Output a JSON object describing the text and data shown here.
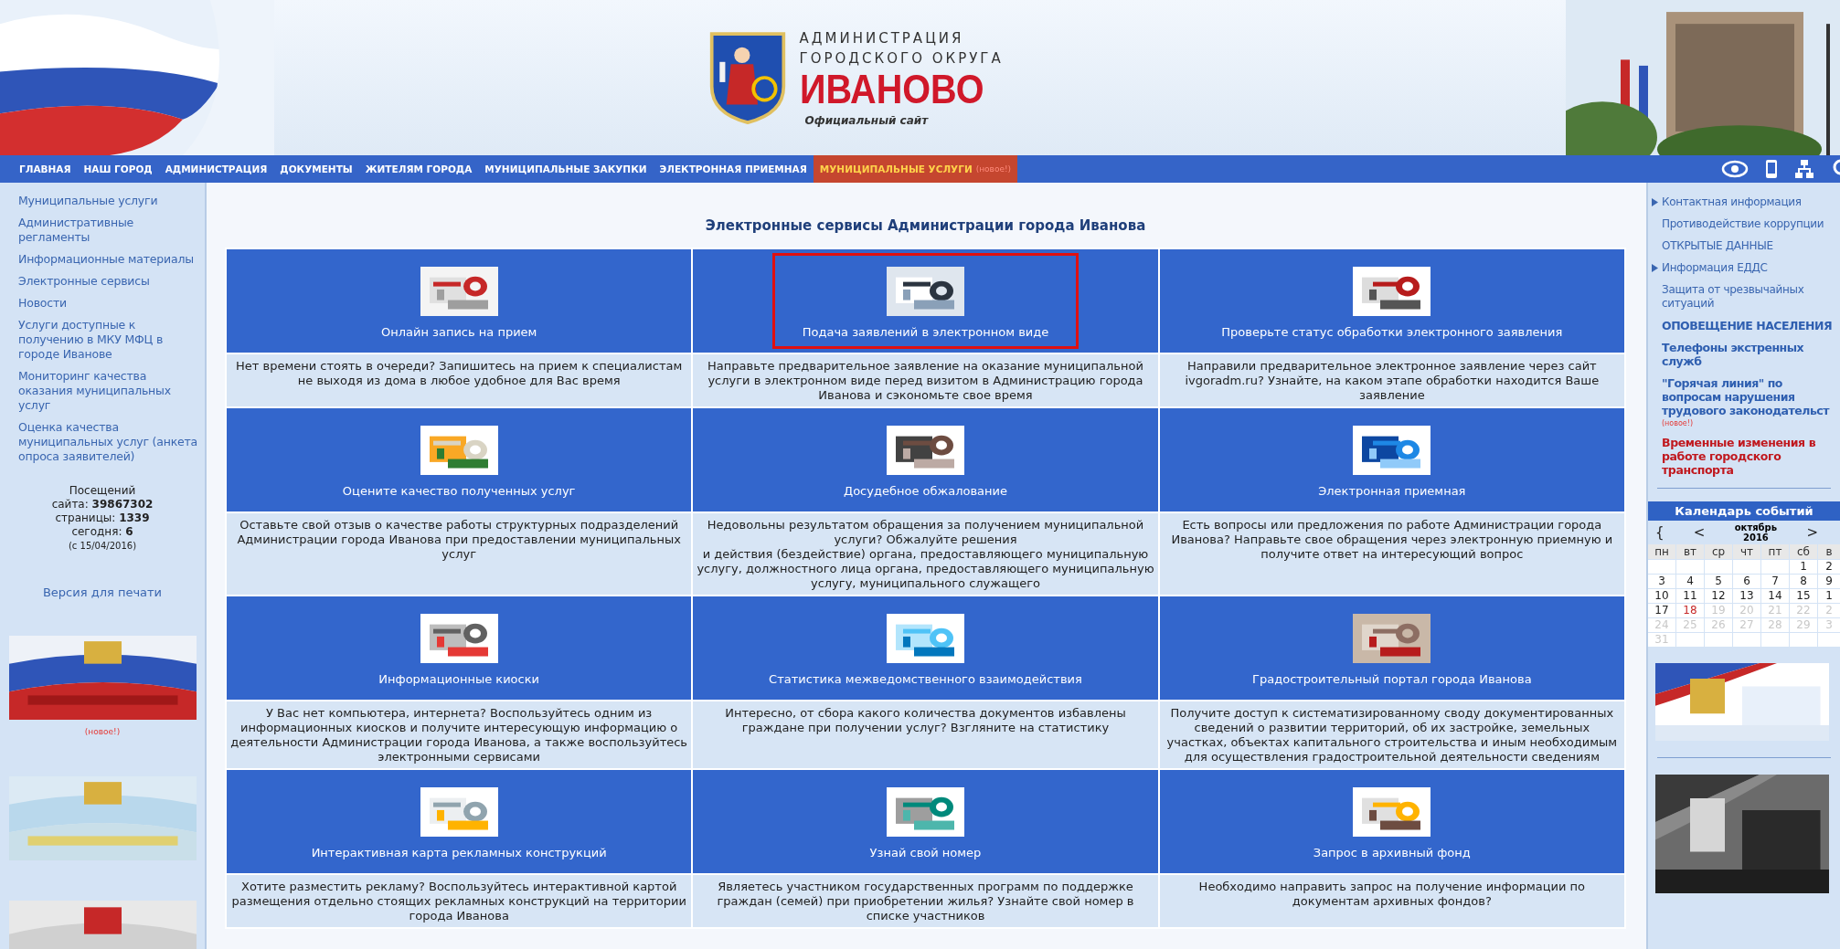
{
  "header": {
    "line1": "АДМИНИСТРАЦИЯ",
    "line2": "ГОРОДСКОГО ОКРУГА",
    "city": "ИВАНОВО",
    "subtitle": "Официальный сайт"
  },
  "nav": [
    {
      "label": "ГЛАВНАЯ",
      "selected": false
    },
    {
      "label": "НАШ ГОРОД",
      "selected": false
    },
    {
      "label": "АДМИНИСТРАЦИЯ",
      "selected": false
    },
    {
      "label": "ДОКУМЕНТЫ",
      "selected": false
    },
    {
      "label": "ЖИТЕЛЯМ ГОРОДА",
      "selected": false
    },
    {
      "label": "МУНИЦИПАЛЬНЫЕ ЗАКУПКИ",
      "selected": false
    },
    {
      "label": "ЭЛЕКТРОННАЯ ПРИЕМНАЯ",
      "selected": false
    },
    {
      "label": "МУНИЦИПАЛЬНЫЕ УСЛУГИ",
      "selected": true,
      "badge": "(новое!)"
    }
  ],
  "left_menu": [
    "Муниципальные услуги",
    "Административные регламенты",
    "Информационные материалы",
    "Электронные сервисы",
    "Новости",
    "Услуги доступные к получению в МКУ МФЦ в городе Иванове",
    "Мониторинг качества оказания муниципальных услуг",
    "Оценка качества муниципальных услуг (анкета опроса заявителей)"
  ],
  "visits": {
    "lines": [
      "Посещений",
      "сайта: **39867302**",
      "страницы: **1339**",
      "сегодня: **6**"
    ],
    "since": "(с 15/04/2016)"
  },
  "print_link": "Версия для печати",
  "left_banners": [
    {
      "kind": "picture",
      "note": "(новое!)"
    },
    {
      "kind": "picture"
    },
    {
      "kind": "picture"
    }
  ],
  "main_title": "Электронные сервисы Администрации города Иванова",
  "services": [
    {
      "title": "Онлайн запись на прием",
      "description": "Нет времени стоять в очереди? Запишитесь на прием к специалистам не выходя из дома в любое удобное для Вас время",
      "highlighted": false
    },
    {
      "title": "Подача заявлений в электронном виде",
      "description": "Направьте предварительное заявление на оказание муниципальной услуги в электронном виде перед визитом в Администрацию города Иванова и сэкономьте свое время",
      "highlighted": true
    },
    {
      "title": "Проверьте статус обработки электронного заявления",
      "description": "Направили предварительное электронное заявление через сайт ivgoradm.ru? Узнайте, на каком этапе обработки находится Ваше заявление",
      "highlighted": false
    },
    {
      "title": "Оцените качество полученных услуг",
      "description": "Оставьте свой отзыв о качестве работы структурных подразделений Администрации города Иванова при предоставлении муниципальных услуг",
      "highlighted": false
    },
    {
      "title": "Досудебное обжалование",
      "description": "Недовольны результатом обращения за получением муниципальной услуги? Обжалуйте решения\nи действия (бездействие) органа, предоставляющего муниципальную услугу, должностного лица органа, предоставляющего муниципальную услугу, муниципального служащего",
      "highlighted": false
    },
    {
      "title": "Электронная приемная",
      "description": "Есть вопросы или предложения по работе Администрации города Иванова? Направьте свое обращения через электронную приемную и получите ответ на интересующий вопрос",
      "highlighted": false
    },
    {
      "title": "Информационные киоски",
      "description": "У Вас нет компьютера, интернета? Воспользуйтесь одним из информационных киосков и получите интересующую информацию о деятельности Администрации города Иванова, а также воспользуйтесь электронными сервисами",
      "highlighted": false
    },
    {
      "title": "Статистика межведомственного взаимодействия",
      "description": "Интересно, от сбора какого количества документов избавлены граждане при получении услуг? Взгляните на статистику",
      "highlighted": false
    },
    {
      "title": "Градостроительный портал города Иванова",
      "description": "Получите доступ к систематизированному своду документированных сведений о развитии территорий, об их застройке, земельных участках, объектах капитального строительства и иным необходимым для осуществления градостроительной деятельности сведениям",
      "highlighted": false
    },
    {
      "title": "Интерактивная карта рекламных конструкций",
      "description": "Хотите разместить рекламу? Воспользуйтесь интерактивной картой размещения отдельно стоящих рекламных конструкций на территории города Иванова",
      "highlighted": false
    },
    {
      "title": "Узнай свой номер",
      "description": "Являетесь участником государственных программ по поддержке граждан (семей) при приобретении жилья? Узнайте свой номер в списке участников",
      "highlighted": false
    },
    {
      "title": "Запрос в архивный фонд",
      "description": "Необходимо направить запрос на получение информации по документам архивных фондов?",
      "highlighted": false
    }
  ],
  "right_menu": [
    {
      "text": "Контактная информация",
      "kind": "arrow"
    },
    {
      "text": "Противодействие коррупции",
      "kind": "plain"
    },
    {
      "text": "ОТКРЫТЫЕ ДАННЫЕ",
      "kind": "plain"
    },
    {
      "text": "Информация ЕДДС",
      "kind": "arrow"
    },
    {
      "text": "Защита от чрезвычайных ситуаций",
      "kind": "plain"
    },
    {
      "text": "ОПОВЕЩЕНИЕ НАСЕЛЕНИЯ",
      "kind": "bold"
    },
    {
      "text": "Телефоны экстренных служб",
      "kind": "bold"
    },
    {
      "text": "\"Горячая линия\" по вопросам нарушения трудового законодательст",
      "kind": "bold",
      "note": "(новое!)"
    },
    {
      "text": "Временные изменения в работе городского транспорта",
      "kind": "alert"
    }
  ],
  "calendar": {
    "title": "Календарь событий",
    "prev_year": "{",
    "prev": "<",
    "month": "октябрь",
    "year": "2016",
    "next": ">",
    "weekdays": [
      "пн",
      "вт",
      "ср",
      "чт",
      "пт",
      "сб",
      "в"
    ],
    "weeks": [
      [
        {
          "kind": "empty"
        },
        {
          "kind": "empty"
        },
        {
          "kind": "empty"
        },
        {
          "kind": "empty"
        },
        {
          "kind": "empty"
        },
        {
          "t": "1",
          "kind": "past"
        },
        {
          "t": "2",
          "kind": "past"
        }
      ],
      [
        {
          "t": "3",
          "kind": "past"
        },
        {
          "t": "4",
          "kind": "past"
        },
        {
          "t": "5",
          "kind": "past"
        },
        {
          "t": "6",
          "kind": "past"
        },
        {
          "t": "7",
          "kind": "past"
        },
        {
          "t": "8",
          "kind": "past"
        },
        {
          "t": "9",
          "kind": "past"
        }
      ],
      [
        {
          "t": "10",
          "kind": "past"
        },
        {
          "t": "11",
          "kind": "past"
        },
        {
          "t": "12",
          "kind": "past"
        },
        {
          "t": "13",
          "kind": "past"
        },
        {
          "t": "14",
          "kind": "past"
        },
        {
          "t": "15",
          "kind": "past"
        },
        {
          "t": "1",
          "kind": "past"
        }
      ],
      [
        {
          "t": "17",
          "kind": "past"
        },
        {
          "t": "18",
          "kind": "today"
        },
        {
          "t": "19",
          "kind": "future"
        },
        {
          "t": "20",
          "kind": "future"
        },
        {
          "t": "21",
          "kind": "future"
        },
        {
          "t": "22",
          "kind": "future"
        },
        {
          "t": "2",
          "kind": "future"
        }
      ],
      [
        {
          "t": "24",
          "kind": "future"
        },
        {
          "t": "25",
          "kind": "future"
        },
        {
          "t": "26",
          "kind": "future"
        },
        {
          "t": "27",
          "kind": "future"
        },
        {
          "t": "28",
          "kind": "future"
        },
        {
          "t": "29",
          "kind": "future"
        },
        {
          "t": "3",
          "kind": "future"
        }
      ],
      [
        {
          "t": "31",
          "kind": "future"
        },
        {
          "kind": "empty"
        },
        {
          "kind": "empty"
        },
        {
          "kind": "empty"
        },
        {
          "kind": "empty"
        },
        {
          "kind": "empty"
        },
        {
          "kind": "empty"
        }
      ]
    ]
  },
  "right_banners": [
    {
      "kind": "picture"
    },
    {
      "kind": "picture"
    }
  ]
}
